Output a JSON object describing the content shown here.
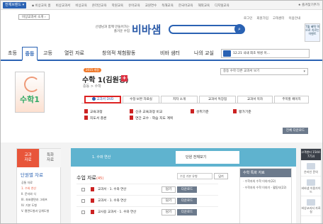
{
  "topbar": {
    "site_btn": "전체브랜드 ▾",
    "links": [
      "▪ 비상교육 홈",
      "비상교과서",
      "비상교육",
      "온라인교육",
      "학원교육",
      "유아교육",
      "교원연수",
      "독해교육",
      "한국어교육",
      "해외교육",
      "디지털교육"
    ],
    "favorite": "★ 즐겨찾기추가"
  },
  "header": {
    "year_btn": "비상교과서 소개 ›",
    "tagline": "선생님과 함께 만들어가는 즐거운 수업",
    "logo": "비바샘",
    "search_icon": "search-icon",
    "util_links": [
      "로그인",
      "회원가입",
      "고객센터",
      "이용안내"
    ],
    "side_ad": "7월 혜택 역으로 치르는 이벤트"
  },
  "nav": {
    "items": [
      "초등",
      "중등",
      "고등",
      "열린 자료",
      "창의적 체험활동",
      "비바 샘터",
      "나의 교실"
    ],
    "active_index": 1,
    "banner": "12.21 국내 최초 위성 이..."
  },
  "book": {
    "cover_label": "수학1",
    "grade_badge": "2015 개정",
    "title": "수학 1(김원경)",
    "breadcrumb": "중등 > 수학",
    "other_select": "중등 수학 다른 교과서 보기",
    "tabs": [
      "교과서 DVD",
      "수정·보완 자료실",
      "저자 소개",
      "교과서 특장점",
      "교과서 목차",
      "주목할 페이지"
    ],
    "resources": [
      [
        "교육과정",
        "지도서 총론"
      ],
      [
        "신규 교육과정 비교",
        "연간 교수 · 학습 지도 계획"
      ],
      [
        "성취기준"
      ],
      [
        "평가기준"
      ]
    ],
    "download_all": "전체 다운로드"
  },
  "lower": {
    "side_tabs": [
      "교과\n자료",
      "특화\n자료"
    ],
    "unit_heading": "단원별 자료",
    "unit_list": [
      "공통 자료",
      "1. 수와 연산",
      "II. 문자와 식",
      "III. 좌표평면과 그래프",
      "IV. 기본 도형",
      "V. 평면도형과 입체도형"
    ],
    "unit_selected_index": 1,
    "unit_bar_label": "1. 수와 연산",
    "unit_all": "단원 전체보기",
    "materials_title": "수업 자료",
    "materials_count": "(45)",
    "sort_select": "수업 기본 유형",
    "select_btn": "담기",
    "download_btn": "다운로드",
    "rows": [
      {
        "title": "교과서 · 1. 수와 연산",
        "btn1": "담기",
        "btn2": "다운로드"
      },
      {
        "title": "교과서 · 1. 수와 연산",
        "btn1": "담기",
        "btn2": "다운로드"
      },
      {
        "title": "교사용 교과서 · 1. 수와 연산",
        "btn1": "담기",
        "btn2": "다운로드"
      }
    ],
    "related": {
      "title": "수학 특화 자료",
      "items": [
        "· 수학자의 수학 이야기(22)",
        "· 수학자의 수학 이야기 - 활동지(22)"
      ]
    },
    "rail": {
      "phone": "고객센터 1544-7714",
      "items": [
        "온라인 문의",
        "비바샘 이용가이드",
        "비상교과서 자료실"
      ]
    }
  }
}
